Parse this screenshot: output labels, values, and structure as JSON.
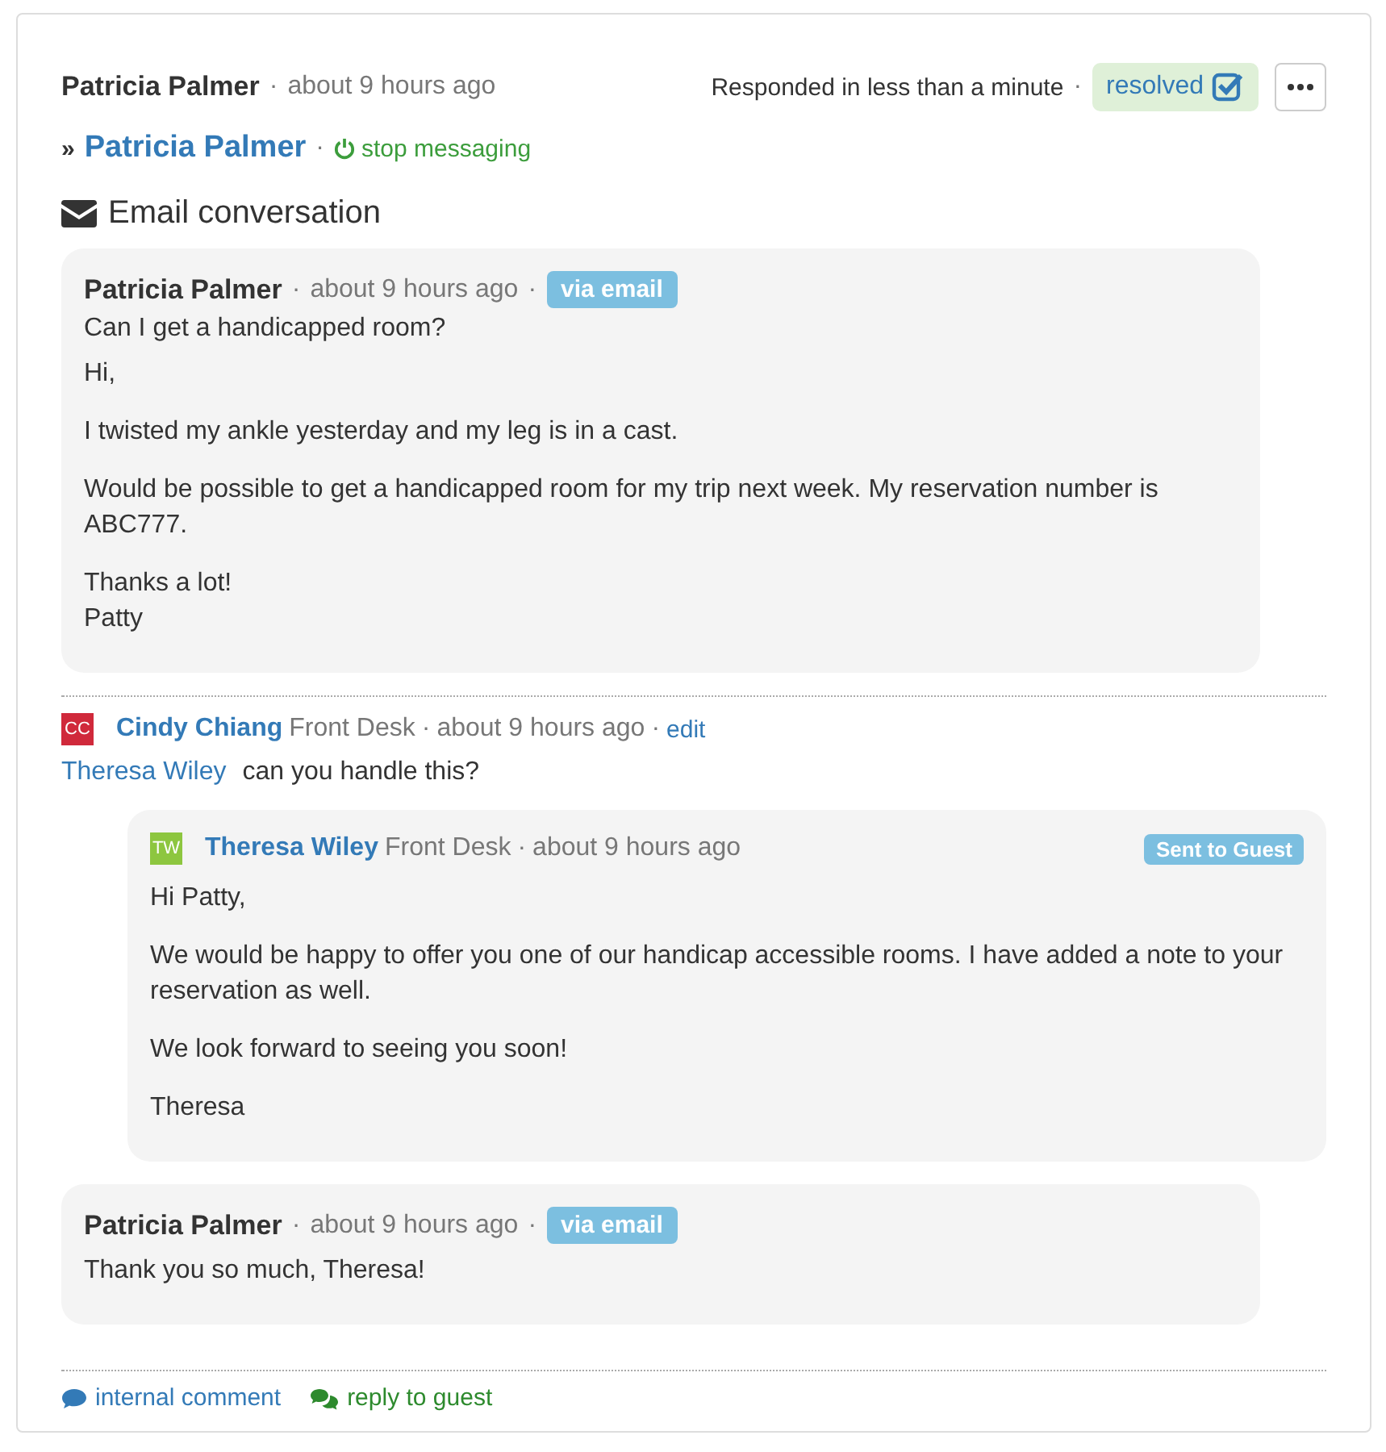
{
  "header": {
    "author": "Patricia Palmer",
    "time": "about 9 hours ago",
    "response": "Responded in less than a minute",
    "status": {
      "label": "resolved",
      "checked": true
    }
  },
  "recipient": {
    "prefix": "»",
    "name": "Patricia Palmer",
    "action": "stop messaging"
  },
  "separator": "·",
  "section_title": "Email conversation",
  "thread": [
    {
      "kind": "email",
      "author": "Patricia Palmer",
      "time": "about 9 hours ago",
      "badge": "via email",
      "subject": "Can I get a handicapped room?",
      "paragraphs": [
        "Hi,",
        "I twisted my ankle yesterday and my leg is in a cast.",
        "Would be possible to get a handicapped room for my trip next week. My reservation number is ABC777.",
        "Thanks a lot!\nPatty"
      ]
    },
    {
      "kind": "comment",
      "initials": "CC",
      "color": "#d0293b",
      "author": "Cindy Chiang",
      "role": "Front Desk",
      "time": "about 9 hours ago",
      "action": "edit",
      "mention": "Theresa Wiley",
      "text": "can you handle this?",
      "reply": {
        "initials": "TW",
        "color": "#8dc63f",
        "author": "Theresa Wiley",
        "role": "Front Desk",
        "time": "about 9 hours ago",
        "badge": "Sent to Guest",
        "paragraphs": [
          "Hi Patty,",
          "We would be happy to offer you one of our handicap accessible rooms. I have added a note to your reservation as well.",
          "We look forward to seeing you soon!",
          "Theresa"
        ]
      }
    },
    {
      "kind": "email",
      "author": "Patricia Palmer",
      "time": "about 9 hours ago",
      "badge": "via email",
      "paragraphs": [
        "Thank you so much, Theresa!"
      ]
    }
  ],
  "footer_actions": [
    {
      "kind": "comment",
      "label": "internal comment"
    },
    {
      "kind": "reply",
      "label": "reply to guest"
    }
  ]
}
